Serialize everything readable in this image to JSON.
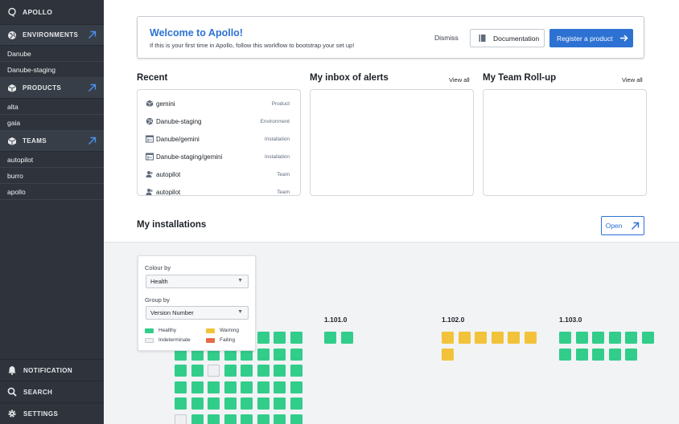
{
  "colors": {
    "sidebar_bg": "#2f343c",
    "accent": "#2d72d2",
    "healthy": "#32cd8a",
    "warning": "#f2c33a",
    "failing": "#e86a48",
    "indeterminate": "#eef0f2"
  },
  "sidebar": {
    "app_title": "APOLLO",
    "sections": [
      {
        "label": "ENVIRONMENTS",
        "icon": "globe-icon",
        "items": [
          "Danube",
          "Danube-staging"
        ]
      },
      {
        "label": "PRODUCTS",
        "icon": "cube-icon",
        "items": [
          "alta",
          "gaia"
        ]
      },
      {
        "label": "TEAMS",
        "icon": "cube-icon",
        "items": [
          "autopilot",
          "burro",
          "apollo"
        ]
      }
    ],
    "bottom": [
      {
        "label": "NOTIFICATION",
        "icon": "bell-icon"
      },
      {
        "label": "SEARCH",
        "icon": "search-icon"
      },
      {
        "label": "SETTINGS",
        "icon": "gear-icon"
      }
    ]
  },
  "welcome": {
    "title": "Welcome to Apollo!",
    "subtitle": "If this is your first time in Apollo, follow this workflow to bootstrap your set up!",
    "dismiss_label": "Dismiss",
    "documentation_label": "Documentation",
    "register_label": "Register a product"
  },
  "recent": {
    "title": "Recent",
    "items": [
      {
        "name": "gemini",
        "type": "Product",
        "icon": "cube-icon"
      },
      {
        "name": "Danube-staging",
        "type": "Environment",
        "icon": "globe-icon"
      },
      {
        "name": "Danube/gemini",
        "type": "Installation",
        "icon": "installation-icon"
      },
      {
        "name": "Danube-staging/gemini",
        "type": "Installation",
        "icon": "installation-icon"
      },
      {
        "name": "autopilot",
        "type": "Team",
        "icon": "people-icon"
      },
      {
        "name": "autopilot",
        "type": "Team",
        "icon": "people-icon"
      }
    ]
  },
  "alerts": {
    "title": "My inbox of alerts",
    "view_all": "View all"
  },
  "rollup": {
    "title": "My Team Roll-up",
    "view_all": "View all"
  },
  "installations": {
    "title": "My installations",
    "open_label": "Open",
    "filter": {
      "colour_by_label": "Colour by",
      "colour_by_value": "Health",
      "group_by_label": "Group by",
      "group_by_value": "Version Number",
      "legend": [
        {
          "label": "Healthy",
          "status": "healthy"
        },
        {
          "label": "Warning",
          "status": "warning"
        },
        {
          "label": "Indeterminate",
          "status": "indeterminate"
        },
        {
          "label": "Failing",
          "status": "failing"
        }
      ]
    },
    "groups": [
      {
        "version": "",
        "columns": 8,
        "tiles": [
          "healthy",
          "healthy",
          "healthy",
          "healthy",
          "healthy",
          "healthy",
          "healthy",
          "healthy",
          "healthy",
          "healthy",
          "healthy",
          "healthy",
          "healthy",
          "healthy",
          "healthy",
          "healthy",
          "healthy",
          "healthy",
          "indeterminate",
          "healthy",
          "healthy",
          "healthy",
          "healthy",
          "healthy",
          "healthy",
          "healthy",
          "healthy",
          "healthy",
          "healthy",
          "healthy",
          "healthy",
          "healthy",
          "healthy",
          "healthy",
          "healthy",
          "healthy",
          "healthy",
          "healthy",
          "healthy",
          "healthy",
          "indeterminate",
          "healthy",
          "healthy",
          "healthy",
          "healthy",
          "healthy",
          "healthy",
          "healthy"
        ]
      },
      {
        "version": "1.101.0",
        "columns": 2,
        "tiles": [
          "healthy",
          "healthy"
        ]
      },
      {
        "version": "1.102.0",
        "columns": 6,
        "tiles": [
          "warning",
          "warning",
          "warning",
          "warning",
          "warning",
          "warning",
          "warning"
        ]
      },
      {
        "version": "1.103.0",
        "columns": 6,
        "tiles": [
          "healthy",
          "healthy",
          "healthy",
          "healthy",
          "healthy",
          "healthy",
          "healthy",
          "healthy",
          "healthy",
          "healthy",
          "healthy"
        ]
      }
    ]
  }
}
